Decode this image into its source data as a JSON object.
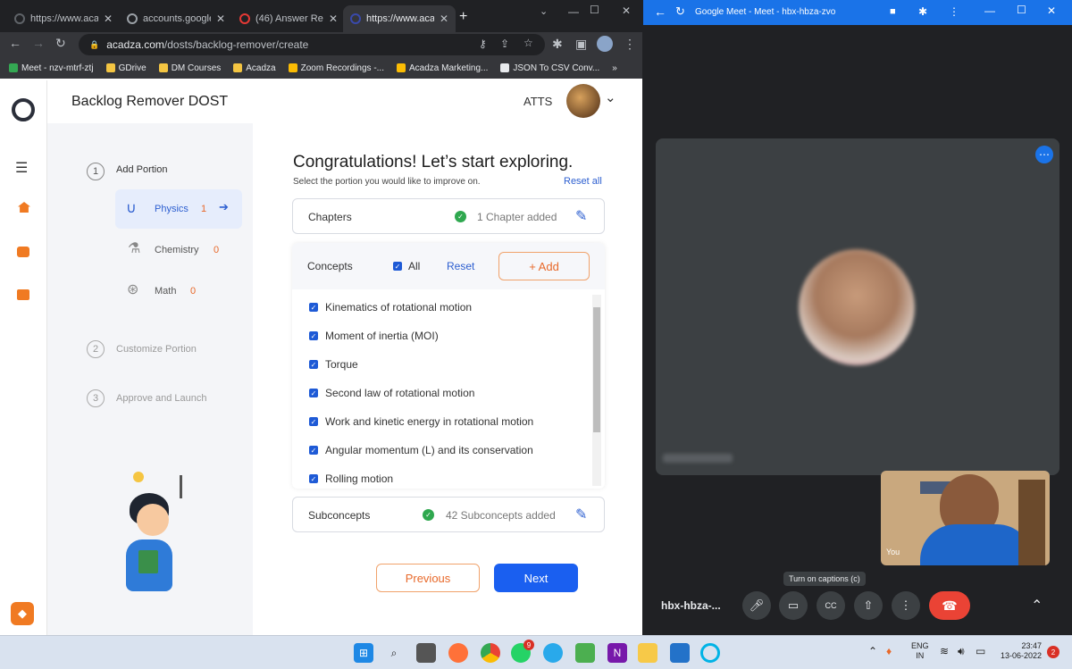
{
  "browser": {
    "tabs": [
      {
        "title": "https://www.aca"
      },
      {
        "title": "accounts.google"
      },
      {
        "title": "(46) Answer Req"
      },
      {
        "title": "https://www.aca"
      }
    ],
    "new_tab": "+",
    "url_domain": "acadza.com",
    "url_path": "/dosts/backlog-remover/create",
    "bookmarks": [
      {
        "label": "Meet - nzv-mtrf-ztj",
        "color": "#34a853"
      },
      {
        "label": "GDrive",
        "color": "#f4c542"
      },
      {
        "label": "DM Courses",
        "color": "#f4c542"
      },
      {
        "label": "Acadza",
        "color": "#f4c542"
      },
      {
        "label": "Zoom Recordings -...",
        "color": "#fbbc04"
      },
      {
        "label": "Acadza Marketing...",
        "color": "#fbbc04"
      },
      {
        "label": "JSON To CSV Conv...",
        "color": "#e8eaed"
      }
    ],
    "more_bookmarks": "»"
  },
  "app": {
    "title": "Backlog Remover DOST",
    "user_name": "ATTS",
    "steps": [
      {
        "num": "1",
        "label": "Add Portion"
      },
      {
        "num": "2",
        "label": "Customize Portion"
      },
      {
        "num": "3",
        "label": "Approve and Launch"
      }
    ],
    "subjects": [
      {
        "name": "Physics",
        "count": "1"
      },
      {
        "name": "Chemistry",
        "count": "0"
      },
      {
        "name": "Math",
        "count": "0"
      }
    ],
    "heading": "Congratulations! Let’s start exploring.",
    "subheading": "Select the portion you would like to improve on.",
    "reset_all": "Reset all",
    "chapters_label": "Chapters",
    "chapters_status": "1 Chapter added",
    "concepts_label": "Concepts",
    "all_label": "All",
    "reset_label": "Reset",
    "add_label": "+ Add",
    "concepts": [
      "Kinematics of rotational motion",
      "Moment of inertia (MOI)",
      "Torque",
      "Second law of rotational motion",
      "Work and kinetic energy in rotational motion",
      "Angular momentum (L) and its conservation",
      "Rolling motion"
    ],
    "subconcepts_label": "Subconcepts",
    "subconcepts_status": "42 Subconcepts added",
    "previous": "Previous",
    "next": "Next"
  },
  "meet": {
    "window_title": "Google Meet - Meet - hbx-hbza-zvo",
    "meeting_code": "hbx-hbza-...",
    "tooltip": "Turn on captions (c)",
    "self_label": "You",
    "end_call_color": "#ea4335"
  },
  "taskbar": {
    "lang": "ENG",
    "region": "IN",
    "time": "23:47",
    "date": "13-06-2022",
    "notifications": "2",
    "whatsapp_badge": "9"
  }
}
